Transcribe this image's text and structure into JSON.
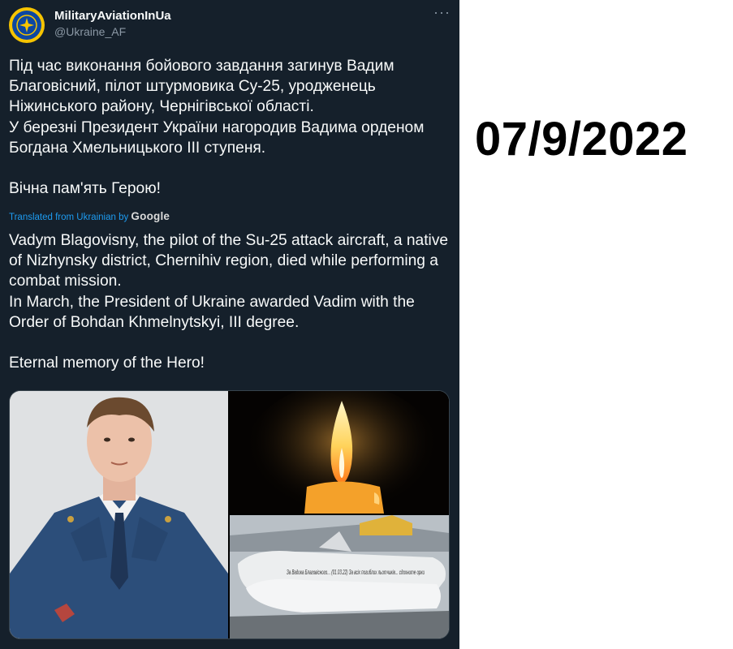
{
  "tweet": {
    "author_name": "MilitaryAviationInUa",
    "author_handle": "@Ukraine_AF",
    "more_icon": "more-horizontal-icon",
    "original_text": "Під час виконання бойового завдання загинув Вадим Благовісний, пілот штурмовика Су-25, уродженець Ніжинського району, Чернігівської області.\nУ березні Президент України нагородив Вадима орденом Богдана Хмельницького ІІІ ступеня.\n\nВічна пам'ять Герою!",
    "translated_label": "Translated from Ukrainian by",
    "translator_brand": "Google",
    "translated_text": "Vadym Blagovisny, the pilot of the Su-25 attack aircraft, a native of Nizhynsky district, Chernihiv region, died while performing a combat mission.\nIn March, the President of Ukraine awarded Vadim with the Order of Bohdan Khmelnytskyi, III degree.\n\nEternal memory of the Hero!"
  },
  "bomb_inscription": "За Вадика Благовісного... (01.03.22) За всіх погиблих льотчиків... сдохните орки",
  "date_stamp": "07/9/2022",
  "colors": {
    "tweet_bg": "#15202b",
    "text": "#f7f9f9",
    "secondary": "#8b98a5",
    "link": "#1d9bf0",
    "avatar_ring": "#f6c400",
    "avatar_core": "#0d47a1"
  }
}
